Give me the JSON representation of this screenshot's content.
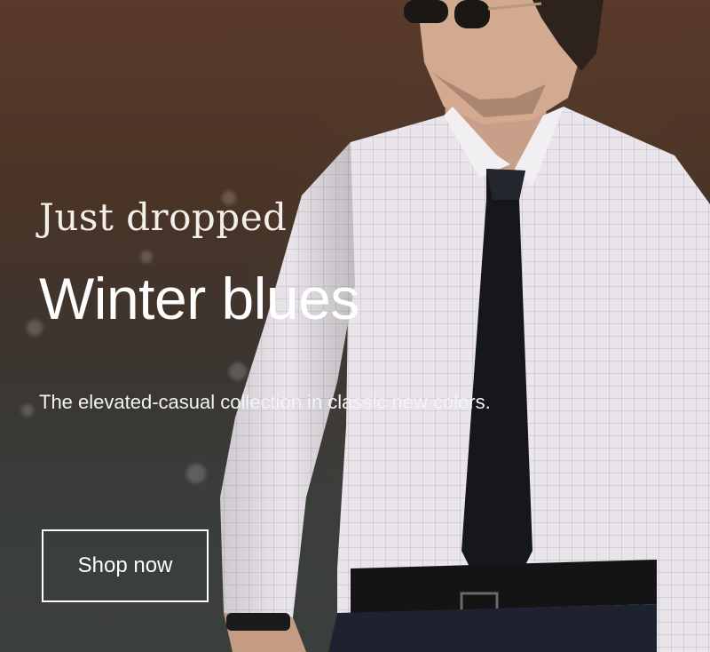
{
  "hero": {
    "eyebrow": "Just dropped",
    "headline": "Winter blues",
    "subhead": "The elevated-casual collection in classic new colors.",
    "cta_label": "Shop now",
    "image": "man-in-checked-shirt-and-black-tie-photo",
    "colors": {
      "text": "#ffffff",
      "background_top": "#5a3a2a",
      "background_bottom": "#3b3f3c"
    }
  }
}
